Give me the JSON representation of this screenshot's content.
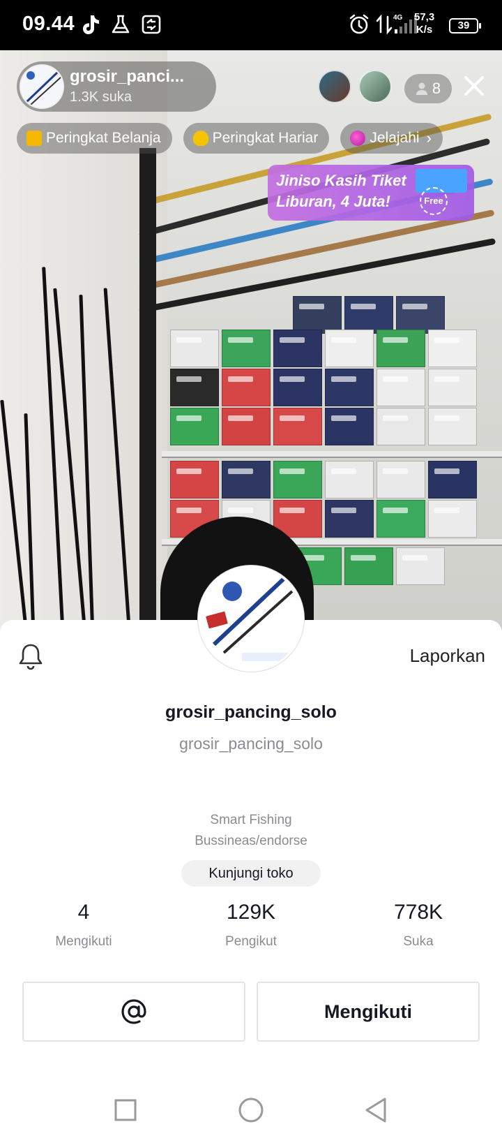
{
  "status_bar": {
    "time": "09.44",
    "network_type": "4G",
    "speed_value": "57,3",
    "speed_unit": "K/s",
    "battery": "39",
    "icons": [
      "tiktok-icon",
      "flask-icon",
      "sync-icon",
      "alarm-icon",
      "data-arrows-icon",
      "signal-icon"
    ]
  },
  "live": {
    "host_name": "grosir_panci...",
    "host_likes": "1.3K suka",
    "viewer_count": "8",
    "chips": [
      {
        "label": "Peringkat Belanja",
        "dot_color": "#f5b700"
      },
      {
        "label": "Peringkat Hariar",
        "dot_color": "#f5c400"
      },
      {
        "label": "Jelajahi",
        "dot_color": "#e040c0"
      }
    ],
    "promo": {
      "line1": "Jiniso Kasih Tiket",
      "line2": "Liburan, 4 Juta!",
      "badge": "Free"
    }
  },
  "profile": {
    "report_label": "Laporkan",
    "display_name": "grosir_pancing_solo",
    "username": "grosir_pancing_solo",
    "bio_line1": "Smart Fishing",
    "bio_line2": "Bussineas/endorse",
    "shop_button": "Kunjungi toko",
    "stats": [
      {
        "value": "4",
        "label": "Mengikuti"
      },
      {
        "value": "129K",
        "label": "Pengikut"
      },
      {
        "value": "778K",
        "label": "Suka"
      }
    ],
    "follow_button": "Mengikuti"
  },
  "colors": {
    "accent_text": "#161823",
    "secondary_text": "#8a8b91",
    "promo_purple": "#b46be6"
  }
}
